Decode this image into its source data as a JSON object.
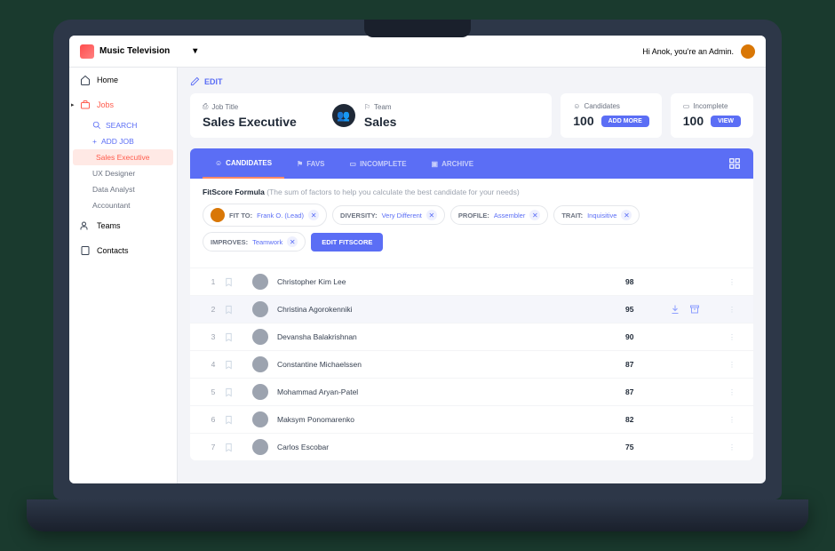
{
  "brand": "Music Television",
  "greeting": "Hi Anok, you're an Admin.",
  "sidebar": {
    "home": "Home",
    "jobs": "Jobs",
    "search": "SEARCH",
    "add": "ADD JOB",
    "items": [
      "Sales Executive",
      "UX Designer",
      "Data Analyst",
      "Accountant"
    ],
    "teams": "Teams",
    "contacts": "Contacts"
  },
  "edit": "EDIT",
  "cards": {
    "jobTitleLabel": "Job Title",
    "jobTitle": "Sales Executive",
    "teamLabel": "Team",
    "team": "Sales",
    "candidatesLabel": "Candidates",
    "candidates": "100",
    "addMore": "ADD MORE",
    "incompleteLabel": "Incomplete",
    "incomplete": "100",
    "view": "VIEW"
  },
  "tabs": {
    "candidates": "CANDIDATES",
    "favs": "FAVS",
    "incomplete": "INCOMPLETE",
    "archive": "ARCHIVE"
  },
  "formula": {
    "title": "FitScore Formula",
    "sub": "(The sum of factors to help you calculate the best candidate for your needs)",
    "chips": [
      {
        "k": "FIT TO:",
        "v": "Frank O. (Lead)",
        "av": true
      },
      {
        "k": "DIVERSITY:",
        "v": "Very Different"
      },
      {
        "k": "PROFILE:",
        "v": "Assembler"
      },
      {
        "k": "TRAIT:",
        "v": "Inquisitive"
      },
      {
        "k": "IMPROVES:",
        "v": "Teamwork"
      }
    ],
    "btn": "EDIT FITSCORE"
  },
  "rows": [
    {
      "i": "1",
      "name": "Christopher Kim Lee",
      "score": "98"
    },
    {
      "i": "2",
      "name": "Christina Agorokenniki",
      "score": "95",
      "hov": true
    },
    {
      "i": "3",
      "name": "Devansha Balakrishnan",
      "score": "90"
    },
    {
      "i": "4",
      "name": "Constantine Michaelssen",
      "score": "87"
    },
    {
      "i": "5",
      "name": "Mohammad Aryan-Patel",
      "score": "87"
    },
    {
      "i": "6",
      "name": "Maksym Ponomarenko",
      "score": "82"
    },
    {
      "i": "7",
      "name": "Carlos Escobar",
      "score": "75"
    }
  ]
}
